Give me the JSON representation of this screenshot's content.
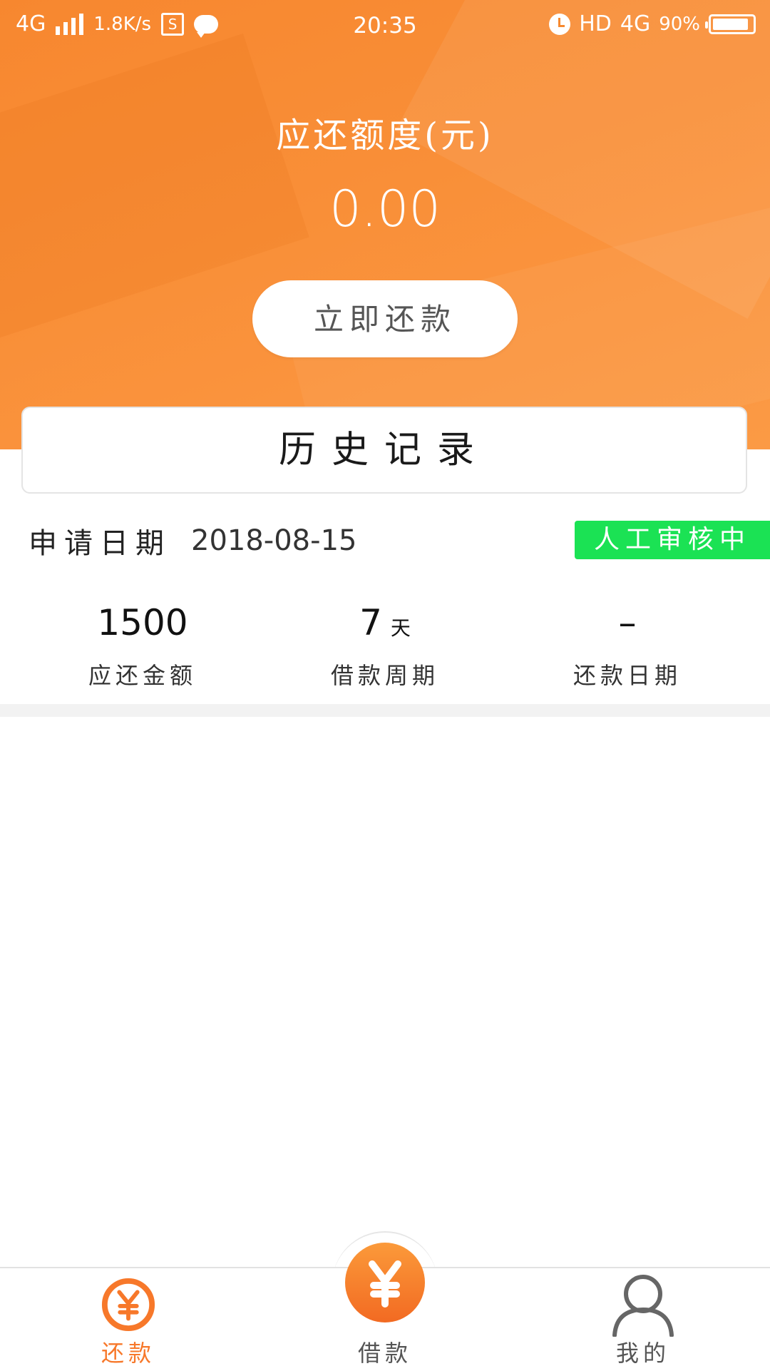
{
  "status_bar": {
    "network": "4G",
    "speed": "1.8K/s",
    "sim_icon_label": "S",
    "time": "20:35",
    "hd": "HD",
    "network_right": "4G",
    "battery": "90%",
    "battery_fraction": 0.9,
    "icons": [
      "signal-icon",
      "sim-icon",
      "message-icon",
      "alarm-icon",
      "battery-icon"
    ]
  },
  "header": {
    "amount_label": "应还额度(元)",
    "amount_value": "0.00",
    "repay_button": "立即还款"
  },
  "history": {
    "title": "历史记录"
  },
  "record": {
    "date_label": "申请日期",
    "date_value": "2018-08-15",
    "status": "人工审核中",
    "stats": [
      {
        "value": "1500",
        "unit": "",
        "caption": "应还金额"
      },
      {
        "value": "7",
        "unit": "天",
        "caption": "借款周期"
      },
      {
        "value": "–",
        "unit": "",
        "caption": "还款日期"
      }
    ]
  },
  "bottom_nav": {
    "items": [
      {
        "label": "还款",
        "icon": "yuan-circle-icon",
        "active": true
      },
      {
        "label": "借款",
        "icon": "yuan-filled-icon",
        "active": false
      },
      {
        "label": "我的",
        "icon": "user-icon",
        "active": false
      }
    ]
  },
  "colors": {
    "primary_orange": "#f98f38",
    "active_nav": "#f7782a",
    "status_green": "#1be254"
  }
}
